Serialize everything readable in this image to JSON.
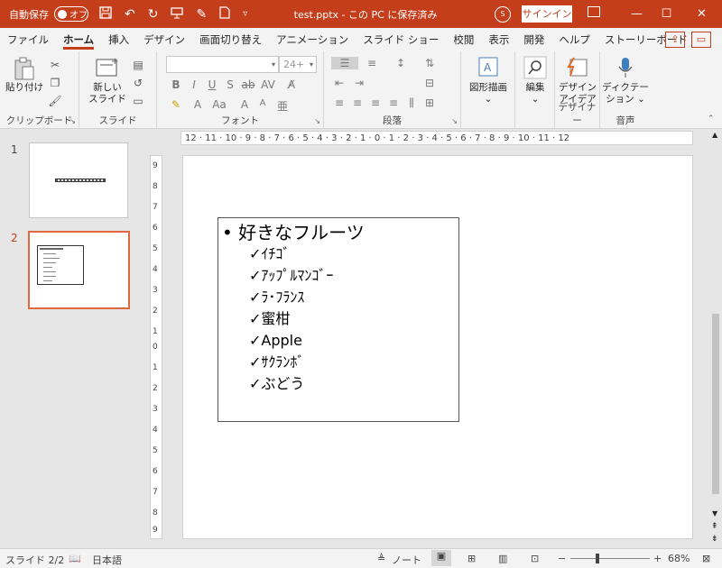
{
  "titlebar": {
    "autosave_label": "自動保存",
    "autosave_state": "オフ",
    "document_title": "test.pptx - この PC に保存済み",
    "user_initials": "S",
    "signin_label": "サインイン",
    "minimize": "—",
    "maximize": "☐",
    "close": "✕"
  },
  "tabs": [
    "ファイル",
    "ホーム",
    "挿入",
    "デザイン",
    "画面切り替え",
    "アニメーション",
    "スライド ショー",
    "校閲",
    "表示",
    "開発",
    "ヘルプ",
    "ストーリーボード"
  ],
  "ribbon": {
    "clipboard": {
      "paste_label": "貼り付け",
      "group_label": "クリップボード"
    },
    "slides": {
      "new_slide_label": "新しい\nスライド",
      "new_slide_l1": "新しい",
      "new_slide_l2": "スライド",
      "group_label": "スライド"
    },
    "font": {
      "font_name": "",
      "font_size": "24+",
      "group_label": "フォント"
    },
    "paragraph": {
      "group_label": "段落"
    },
    "drawing": {
      "label": "図形描画"
    },
    "editing": {
      "label": "編集"
    },
    "designer": {
      "label_l1": "デザイン",
      "label_l2": "アイデア",
      "group_label": "デザイナー"
    },
    "voice": {
      "label_l1": "ディクテー",
      "label_l2": "ション",
      "group_label": "音声"
    }
  },
  "slides_panel": [
    {
      "number": "1"
    },
    {
      "number": "2"
    }
  ],
  "ruler": {
    "horizontal": "12 · 11 · 10 · 9 · 8 · 7 · 6 · 5 · 4 · 3 · 2 · 1 · 0 · 1 · 2 · 3 · 4 · 5 · 6 · 7 · 8 · 9 · 10 · 11 · 12",
    "vertical": [
      "9",
      "8",
      "7",
      "6",
      "5",
      "4",
      "3",
      "2",
      "1",
      "0",
      "1",
      "2",
      "3",
      "4",
      "5",
      "6",
      "7",
      "8",
      "9"
    ]
  },
  "slide": {
    "heading": "• 好きなフルーツ",
    "items": [
      "✓ｲﾁｺﾞ",
      "✓ｱｯﾌﾟﾙﾏﾝｺﾞｰ",
      "✓ﾗ･ﾌﾗﾝｽ",
      "✓蜜柑",
      "✓Apple",
      "✓ｻｸﾗﾝﾎﾞ",
      "✓ぶどう"
    ]
  },
  "statusbar": {
    "slide_counter": "スライド 2/2",
    "language": "日本語",
    "notes_label": "ノート",
    "zoom_level": "68%",
    "zoom_minus": "−",
    "zoom_plus": "+"
  }
}
